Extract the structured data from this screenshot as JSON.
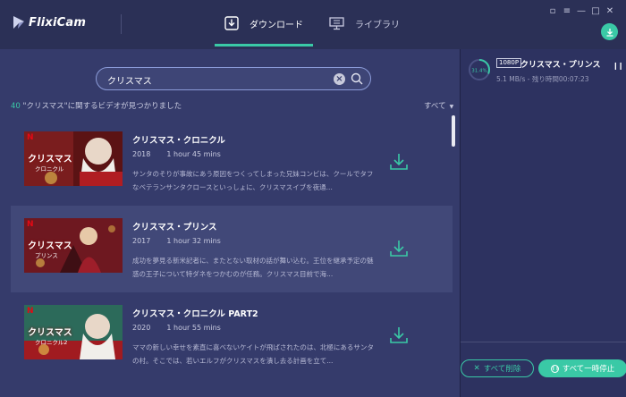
{
  "app": {
    "name": "FlixiCam"
  },
  "tabs": [
    {
      "label": "ダウンロード",
      "active": true
    },
    {
      "label": "ライブラリ",
      "active": false
    }
  ],
  "search": {
    "value": "クリスマス"
  },
  "results": {
    "count": "40",
    "text": " \"クリスマス\"に関するビデオが見つかりました"
  },
  "filter": {
    "label": "すべて"
  },
  "videos": [
    {
      "title": "クリスマス・クロニクル",
      "year": "2018",
      "duration": "1 hour 45 mins",
      "description": "サンタのそりが事故にあう原因をつくってしまった兄妹コンビは、クールでタフなベテランサンタクロースといっしょに、クリスマスイブを夜通...",
      "thumb_title": "クリスマス",
      "thumb_sub": "クロニクル"
    },
    {
      "title": "クリスマス・プリンス",
      "year": "2017",
      "duration": "1 hour 32 mins",
      "description": "成功を夢見る新米記者に、またとない取材の話が舞い込む。王位を継承予定の魅惑の王子について特ダネをつかむのが任務。クリスマス目前で海...",
      "thumb_title": "クリスマス",
      "thumb_sub": "プリンス"
    },
    {
      "title": "クリスマス・クロニクル PART2",
      "year": "2020",
      "duration": "1 hour 55 mins",
      "description": "ママの新しい幸せを素直に喜べないケイトが飛ばされたのは、北極にあるサンタの村。そこでは、若いエルフがクリスマスを潰し去る計画を立て...",
      "thumb_title": "クリスマス",
      "thumb_sub": "クロニクル2"
    }
  ],
  "task": {
    "progress": "31.4%",
    "quality": "1080P",
    "title": "クリスマス・プリンス",
    "status": "5.1 MB/s - 残り時間00:07:23"
  },
  "buttons": {
    "clear_all": "すべて削除",
    "pause_all": "すべて一時停止"
  },
  "colors": {
    "accent": "#3ac9a6",
    "background": "#2b3056",
    "panel": "#353b6b",
    "selected": "#414878"
  }
}
